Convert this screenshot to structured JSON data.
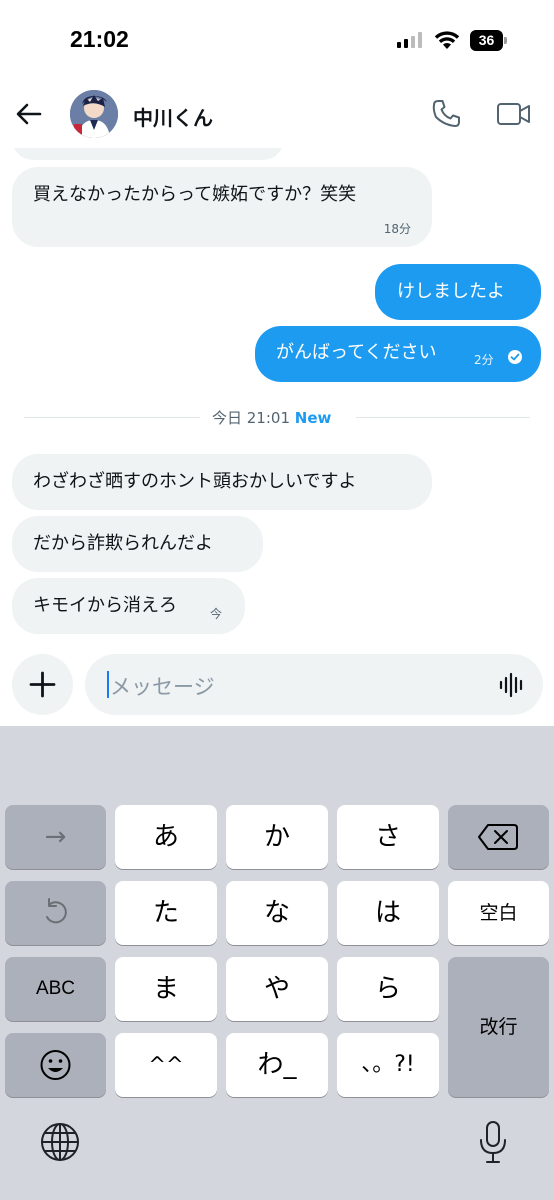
{
  "status_bar": {
    "time": "21:02",
    "battery": "36"
  },
  "header": {
    "contact_name": "中川くん"
  },
  "messages": [
    {
      "text": "買えなかったからって嫉妬ですか？笑笑",
      "time": "18分"
    },
    {
      "text": "けしましたよ"
    },
    {
      "text": "がんばってください",
      "time": "2分"
    }
  ],
  "divider": {
    "label": "今日 21:01",
    "badge": "New"
  },
  "new_messages": [
    {
      "text": "わざわざ晒すのホント頭おかしいですよ"
    },
    {
      "text": "だから詐欺られんだよ"
    },
    {
      "text": "キモイから消えろ",
      "time": "今"
    }
  ],
  "composer": {
    "placeholder": "メッセージ"
  },
  "keyboard": {
    "rows": [
      [
        "→",
        "あ",
        "か",
        "さ",
        "⌫"
      ],
      [
        "↺",
        "た",
        "な",
        "は",
        "空白"
      ],
      [
        "ABC",
        "ま",
        "や",
        "ら",
        "改行"
      ],
      [
        "☺",
        "^^",
        "わ_",
        "、。?!"
      ]
    ],
    "key_next": "→",
    "key_a": "あ",
    "key_ka": "か",
    "key_sa": "さ",
    "key_ta": "た",
    "key_na": "な",
    "key_ha": "は",
    "key_space": "空白",
    "key_abc": "ABC",
    "key_ma": "ま",
    "key_ya": "や",
    "key_ra": "ら",
    "key_return": "改行",
    "key_kaomoji": "^^",
    "key_wa": "わ_",
    "key_punct": "、。?!"
  },
  "colors": {
    "sent_bubble": "#1d9bf0",
    "received_bubble": "#eff3f4",
    "accent": "#1d9bf0",
    "keyboard_bg": "#d3d6dd"
  },
  "icons": [
    "back-arrow-icon",
    "phone-icon",
    "video-camera-icon",
    "plus-icon",
    "voice-waveform-icon",
    "delete-icon",
    "undo-icon",
    "emoji-icon",
    "globe-icon",
    "microphone-icon",
    "read-check-icon"
  ]
}
